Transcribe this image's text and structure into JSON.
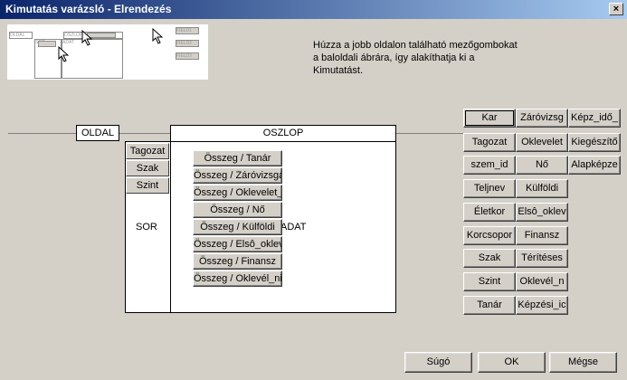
{
  "window": {
    "title": "Kimutatás varázsló - Elrendezés",
    "close_label": "×"
  },
  "preview": {
    "labels": {
      "oldal": "OLDAL",
      "oszlop": "OSZLOP",
      "sor": "SOR",
      "adat": "ADAT",
      "field1": "FIELD1",
      "field2": "FIELD2",
      "field3": "FIELD3"
    }
  },
  "instructions": "Húzza a jobb oldalon található mezőgombokat a baloldali ábrára, így alakíthatja ki a Kimutatást.",
  "layout": {
    "oldal_label": "OLDAL",
    "oszlop_label": "OSZLOP",
    "sor_label": "SOR",
    "adat_label": "ADAT",
    "row_fields": [
      "Tagozat",
      "Szak",
      "Szint"
    ],
    "data_fields": [
      "Összeg / Tanár",
      "Összeg / Záróvizsgá",
      "Összeg / Oklevelet_",
      "Összeg / Nő",
      "Összeg / Külföldi",
      "Összeg / Elsô_oklev",
      "Összeg / Finansz",
      "Összeg / Oklevél_nir"
    ]
  },
  "fields": {
    "col1": [
      "Kar",
      "Tagozat",
      "szem_id",
      "Teljnev",
      "Életkor",
      "Korcsopor",
      "Szak",
      "Szint",
      "Tanár"
    ],
    "col2": [
      "Záróvizsg",
      "Oklevelet",
      "Nő",
      "Külföldi",
      "Elsô_oklev",
      "Finansz",
      "Térítéses",
      "Oklevél_n",
      "Képzési_ic"
    ],
    "col3": [
      "Képz_idő_",
      "Kiegészítő",
      "Alapképze"
    ]
  },
  "buttons": {
    "help": "Súgó",
    "ok": "OK",
    "cancel": "Mégse"
  }
}
